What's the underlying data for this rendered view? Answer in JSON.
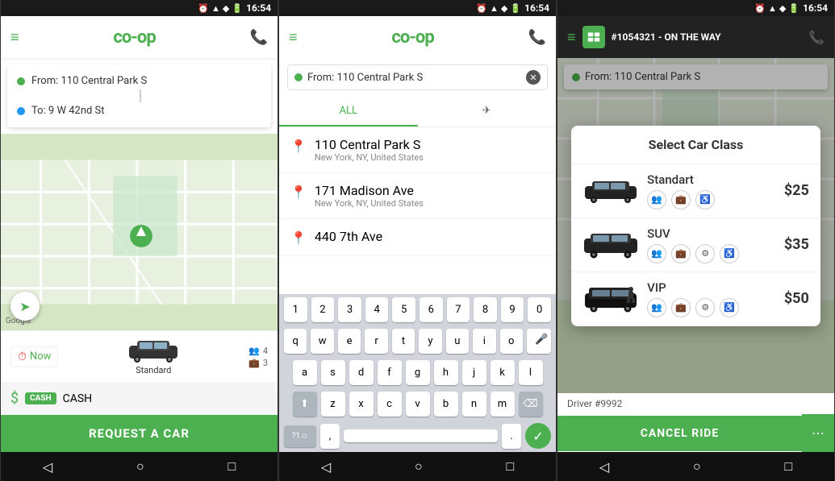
{
  "statusBar": {
    "time": "16:54",
    "icons": "⏰▲◆🔋"
  },
  "screens": [
    {
      "id": "screen1",
      "appBar": {
        "menuIcon": "≡",
        "logo": "co-op",
        "phoneIcon": "📞"
      },
      "route": {
        "from": "From: 110 Central Park S",
        "to": "To: 9 W 42nd St"
      },
      "mapLabel": "Google",
      "rideInfo": {
        "nowLabel": "Now",
        "carName": "Standard",
        "passengers": "4",
        "luggage": "3"
      },
      "payment": {
        "currencyIcon": "$",
        "cashBadge": "CASH",
        "label": "CASH"
      },
      "requestBtn": "REQUEST A CAR"
    },
    {
      "id": "screen2",
      "appBar": {
        "menuIcon": "≡",
        "logo": "co-op",
        "phoneIcon": "📞"
      },
      "searchFrom": "From: 110 Central Park S",
      "clearIcon": "✕",
      "tabs": [
        "ALL",
        "✈"
      ],
      "activeTab": 0,
      "results": [
        {
          "name": "110 Central Park S",
          "sub": "New York, NY, United States"
        },
        {
          "name": "171 Madison Ave",
          "sub": "New York, NY, United States"
        },
        {
          "name": "440 7th Ave",
          "sub": ""
        }
      ],
      "keyboard": {
        "rows": [
          [
            "1",
            "2",
            "3",
            "4",
            "5",
            "6",
            "7",
            "8",
            "9",
            "0"
          ],
          [
            "q",
            "w",
            "e",
            "r",
            "t",
            "y",
            "u",
            "i",
            "o",
            "p"
          ],
          [
            "a",
            "s",
            "d",
            "f",
            "g",
            "h",
            "j",
            "k",
            "l"
          ],
          [
            "z",
            "x",
            "c",
            "v",
            "b",
            "n",
            "m"
          ],
          [
            "?1☺",
            ",",
            "space",
            ".",
            "✓"
          ]
        ]
      }
    },
    {
      "id": "screen3",
      "appBar": {
        "menuIcon": "≡",
        "logoSmall": "co-op",
        "rideId": "#1054321",
        "status": "ON THE WAY",
        "phoneIcon": "📞"
      },
      "route": {
        "from": "From: 110 Central Park S"
      },
      "modal": {
        "title": "Select Car Class",
        "classes": [
          {
            "name": "Standart",
            "price": "$25",
            "icons": [
              "👥",
              "💼",
              "♿"
            ]
          },
          {
            "name": "SUV",
            "price": "$35",
            "icons": [
              "👥",
              "💼",
              "⚙",
              "♿"
            ]
          },
          {
            "name": "VIP",
            "price": "$50",
            "icons": [
              "👥",
              "💼",
              "⚙",
              "♿"
            ]
          }
        ]
      },
      "driverInfo": "Driver #9992",
      "cancelBtn": "CANCEL RIDE",
      "moreIcon": "⋯"
    }
  ],
  "bottomNav": {
    "back": "◁",
    "home": "○",
    "recent": "□"
  }
}
